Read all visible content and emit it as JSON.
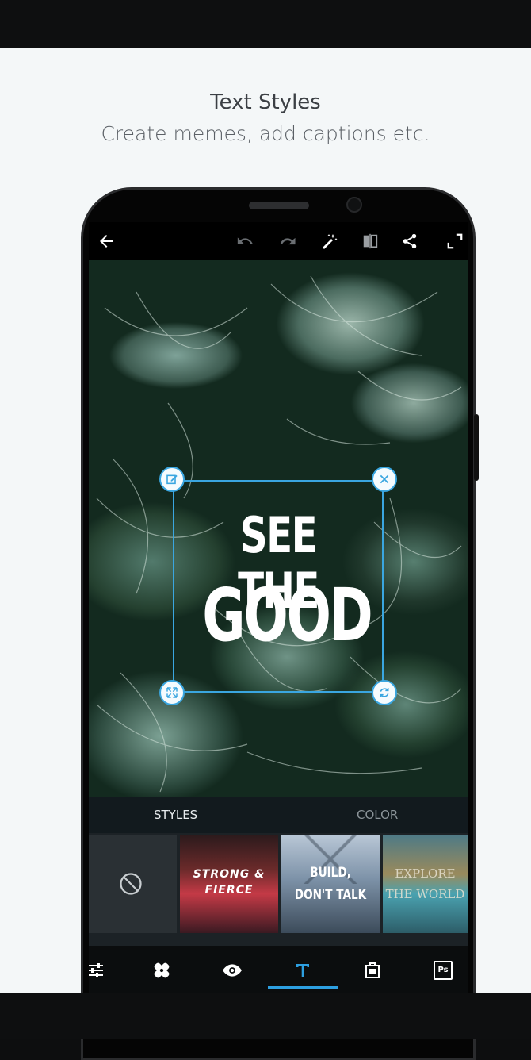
{
  "hero": {
    "title": "Text Styles",
    "subtitle": "Create memes, add captions etc."
  },
  "appbar": {
    "icons": [
      "back-arrow-icon",
      "undo-icon",
      "redo-icon",
      "magic-wand-icon",
      "compare-icon",
      "share-icon",
      "fullscreen-icon"
    ]
  },
  "canvas": {
    "text_line_1": "SEE THE",
    "text_line_2": "GOOD",
    "handles": [
      "edit-icon",
      "close-icon",
      "resize-icon",
      "rotate-icon"
    ]
  },
  "panel": {
    "tabs": [
      {
        "label": "STYLES",
        "active": true
      },
      {
        "label": "COLOR",
        "active": false
      }
    ],
    "style_thumbs": [
      {
        "kind": "none",
        "icon": "no-style-icon"
      },
      {
        "line1": "STRONG &",
        "line2": "FIERCE"
      },
      {
        "line1": "BUILD,",
        "line2": "DON'T TALK"
      },
      {
        "line1": "EXPLORE",
        "line2": "THE WORLD"
      }
    ]
  },
  "toolbar": {
    "icons": [
      "adjust-sliders-icon",
      "healing-icon",
      "eye-icon",
      "text-icon",
      "frame-icon",
      "photoshop-icon"
    ],
    "active": "text-icon",
    "ps_label": "Ps"
  },
  "colors": {
    "accent": "#2d9fe0",
    "background": "#f4f7f8"
  }
}
